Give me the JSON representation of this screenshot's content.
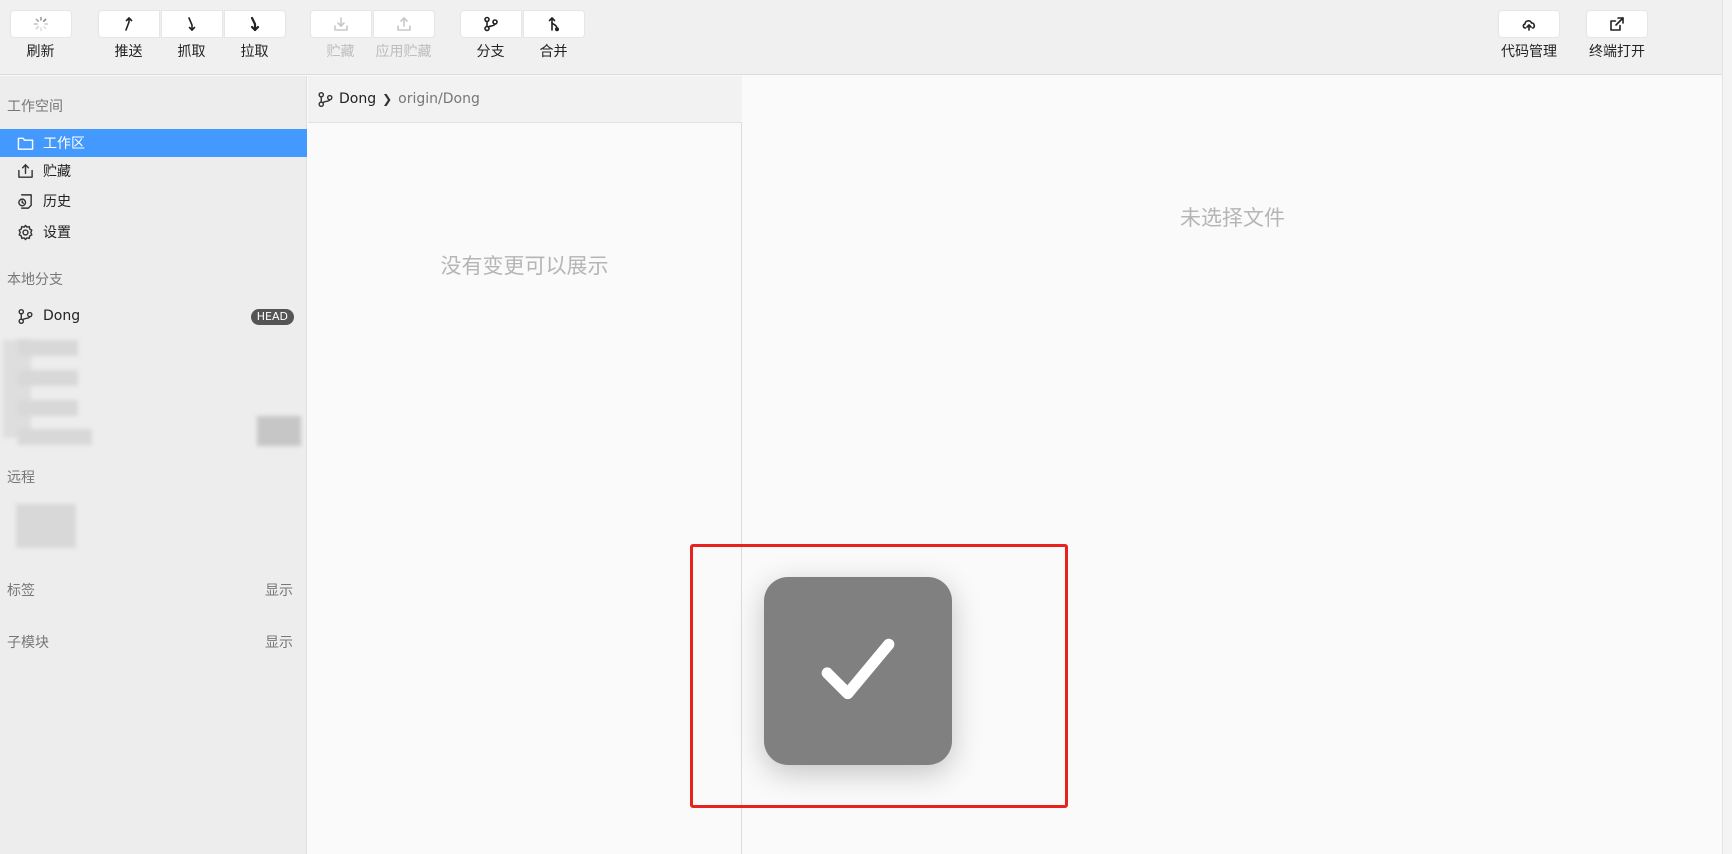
{
  "toolbar": {
    "refresh": "刷新",
    "push": "推送",
    "fetch": "抓取",
    "pull": "拉取",
    "stash": "贮藏",
    "apply_stash": "应用贮藏",
    "branch": "分支",
    "merge": "合并",
    "code_manage": "代码管理",
    "open_terminal": "终端打开"
  },
  "sidebar": {
    "workspace_title": "工作空间",
    "items": [
      {
        "label": "工作区",
        "icon": "folder-icon"
      },
      {
        "label": "贮藏",
        "icon": "stash-icon"
      },
      {
        "label": "历史",
        "icon": "history-icon"
      },
      {
        "label": "设置",
        "icon": "gear-icon"
      }
    ],
    "local_branches_title": "本地分支",
    "local_branch": {
      "name": "Dong",
      "badge": "HEAD"
    },
    "remote_title": "远程",
    "tags_title": "标签",
    "tags_show": "显示",
    "submodules_title": "子模块",
    "submodules_show": "显示"
  },
  "branch_bar": {
    "local": "Dong",
    "remote": "origin/Dong"
  },
  "changes": {
    "empty": "没有变更可以展示"
  },
  "diff": {
    "empty": "未选择文件"
  },
  "colors": {
    "accent": "#4499ff",
    "highlight": "#e8231f",
    "toast": "#808080"
  }
}
